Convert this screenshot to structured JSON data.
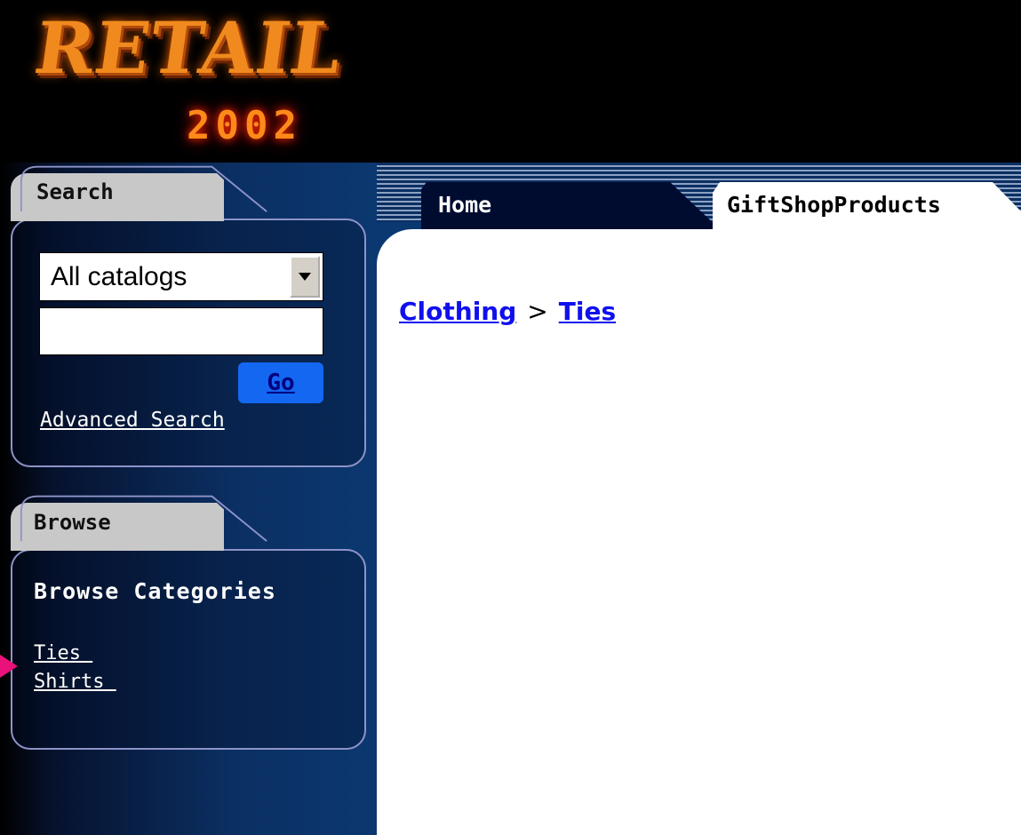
{
  "header": {
    "logo_word": "RETAIL",
    "logo_year": "2002"
  },
  "search_panel": {
    "tab_label": "Search",
    "catalog_select": {
      "selected": "All catalogs"
    },
    "search_input": {
      "value": "",
      "placeholder": ""
    },
    "go_label": "Go",
    "advanced_link": "Advanced Search"
  },
  "browse_panel": {
    "tab_label": "Browse",
    "heading": "Browse Categories",
    "categories": [
      "Ties ",
      "Shirts "
    ]
  },
  "tabs": [
    {
      "label": "Home",
      "active": false
    },
    {
      "label": "GiftShopProducts",
      "active": true
    }
  ],
  "breadcrumb": {
    "items": [
      "Clothing",
      "Ties"
    ],
    "separator": ">"
  },
  "colors": {
    "sidebar": "#0b3870",
    "link_blue": "#1010ee",
    "go_button": "#1467f0",
    "pointer": "#e8127a"
  }
}
